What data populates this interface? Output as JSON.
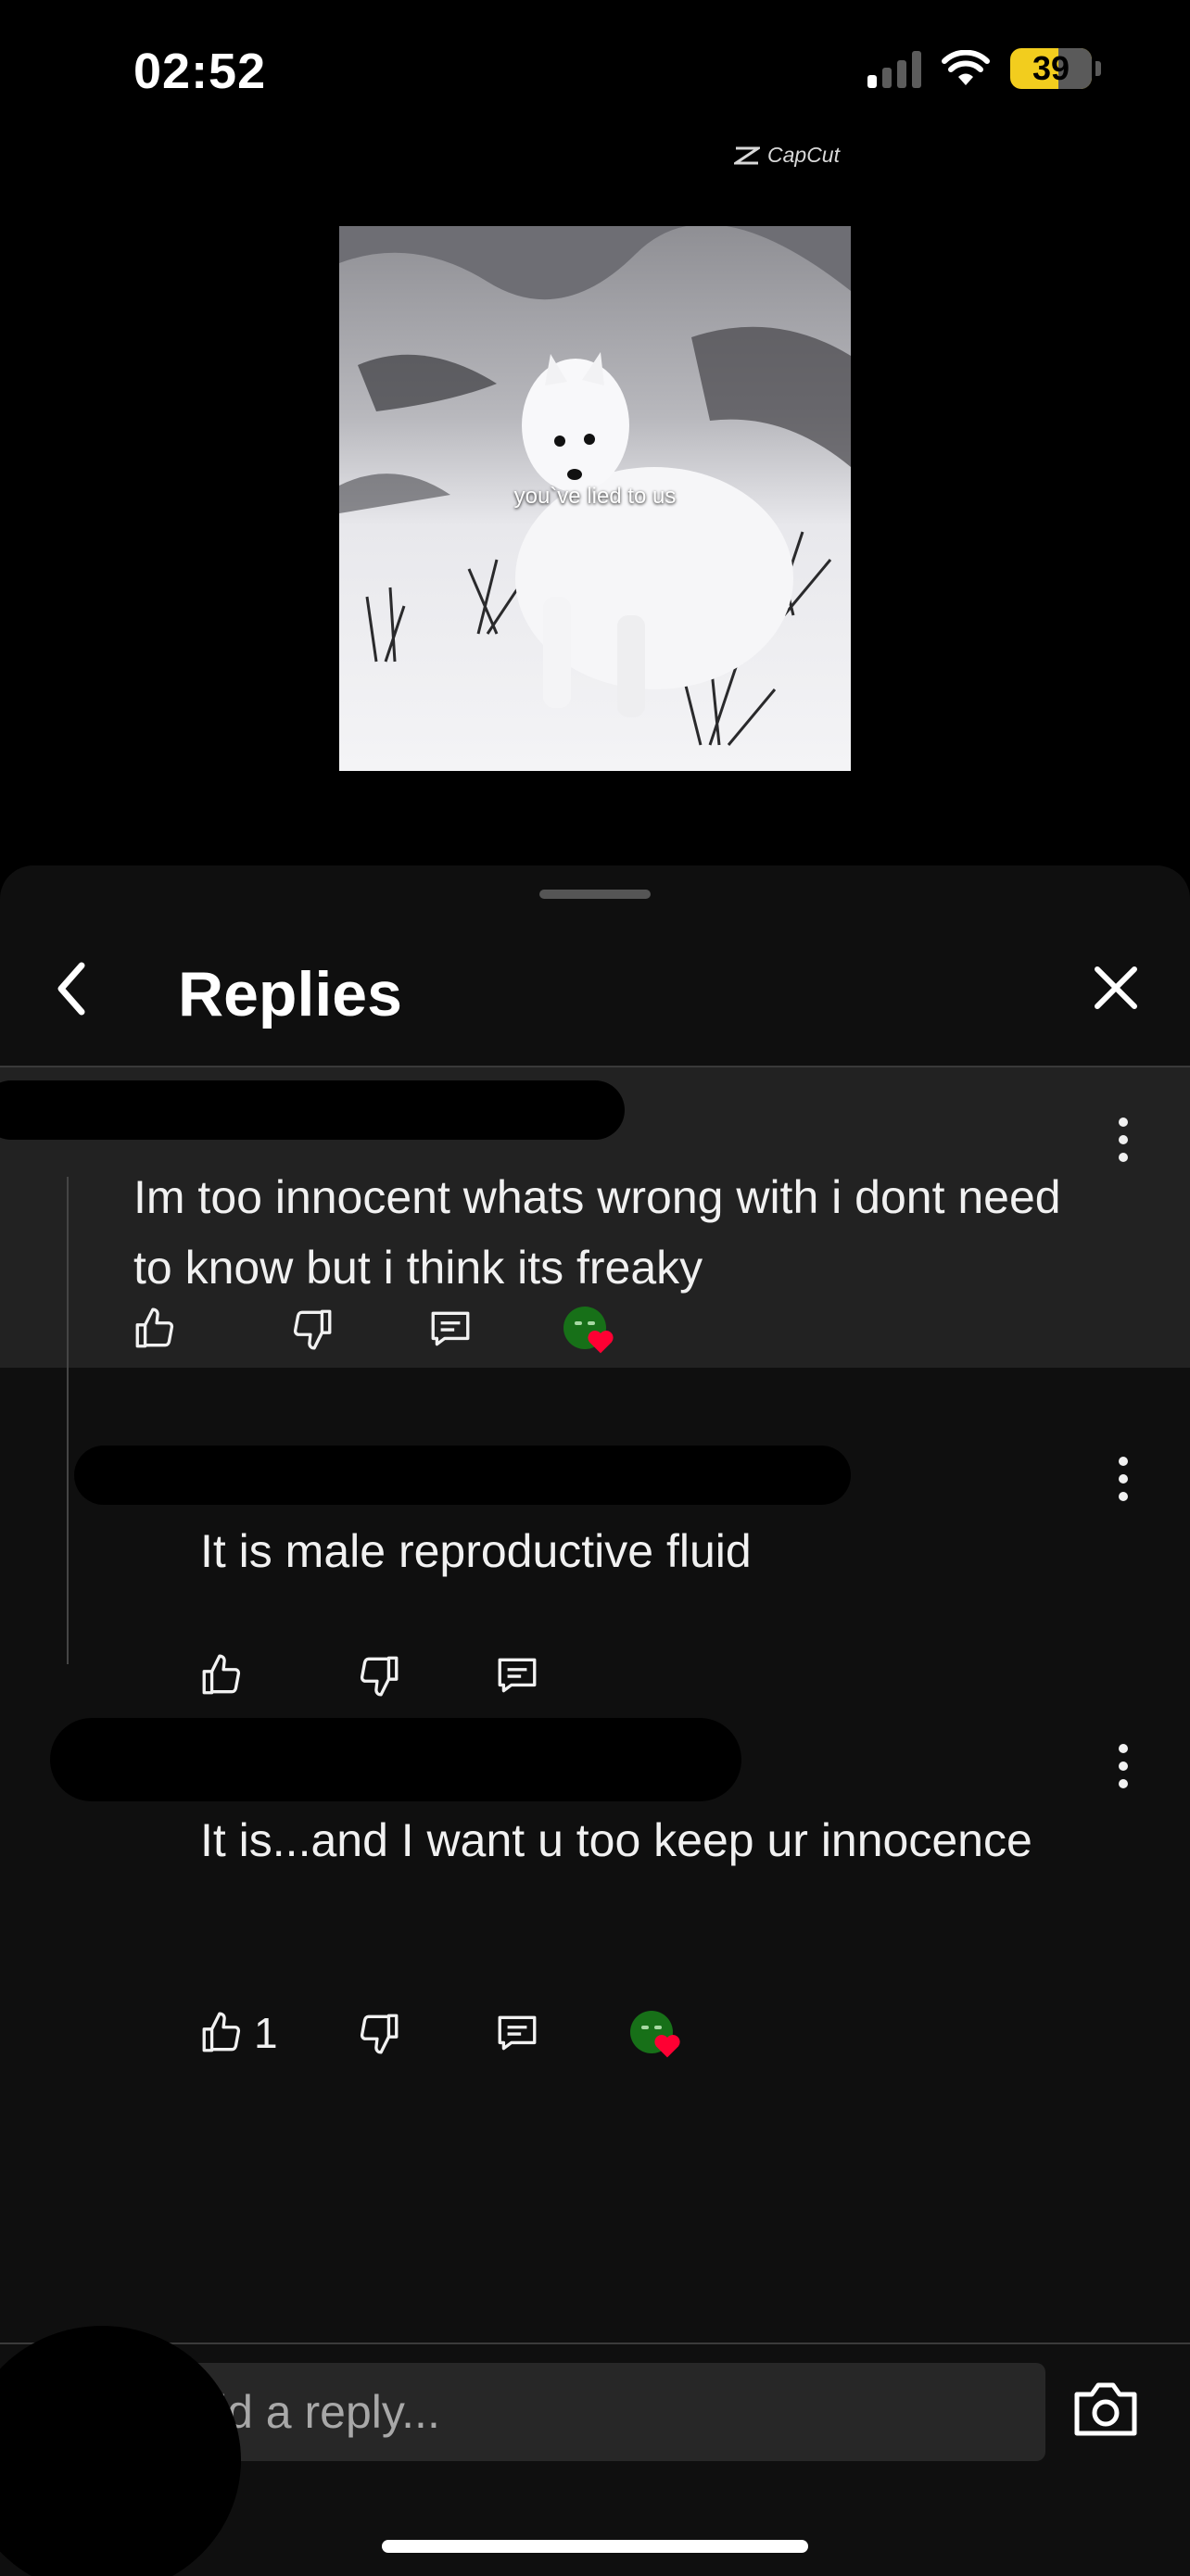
{
  "status_bar": {
    "time": "02:52",
    "battery_level": "39",
    "battery_color": "#f2cd1e"
  },
  "video": {
    "watermark": "CapCut",
    "caption": "you`ve lied to us"
  },
  "sheet": {
    "title": "Replies",
    "back_icon": "chevron-left-icon",
    "close_icon": "close-icon"
  },
  "comments": [
    {
      "text": "Im too innocent whats wrong with i dont need to know but i think its freaky",
      "like_count": "",
      "creator_heart": true
    },
    {
      "text": "It is male reproductive fluid",
      "like_count": "",
      "creator_heart": false
    },
    {
      "text": "It is...and I want u too keep ur innocence",
      "like_count": "1",
      "creator_heart": true
    }
  ],
  "reply_input": {
    "placeholder": "Add a reply...",
    "visible_text": "ld a reply..."
  },
  "colors": {
    "sheet_bg": "#0f0f0f",
    "highlight_bg": "#222222",
    "heart_red": "#ff0033",
    "avatar_green": "#177018"
  }
}
